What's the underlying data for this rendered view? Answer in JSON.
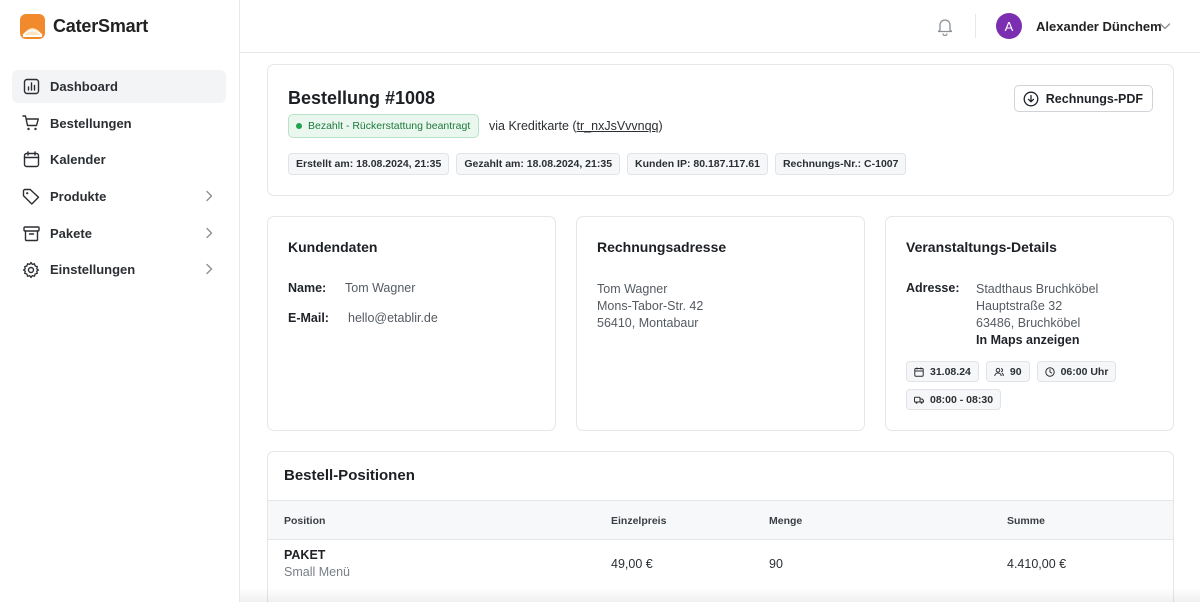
{
  "app": {
    "name": "CaterSmart"
  },
  "sidebar": {
    "items": [
      {
        "label": "Dashboard",
        "icon": "chart-icon",
        "active": true
      },
      {
        "label": "Bestellungen",
        "icon": "cart-icon"
      },
      {
        "label": "Kalender",
        "icon": "calendar-icon"
      },
      {
        "label": "Produkte",
        "icon": "tag-icon",
        "expandable": true
      },
      {
        "label": "Pakete",
        "icon": "box-icon",
        "expandable": true
      },
      {
        "label": "Einstellungen",
        "icon": "gear-icon",
        "expandable": true
      }
    ]
  },
  "topbar": {
    "user_initial": "A",
    "user_name": "Alexander Dünchem",
    "avatar_color": "#7b2fb0"
  },
  "order": {
    "title": "Bestellung #1008",
    "status": "Bezahlt - Rückerstattung beantragt",
    "payment_prefix": "via Kreditkarte (",
    "transaction_id": "tr_nxJsVvvnqq",
    "payment_suffix": ")",
    "pdf_button": "Rechnungs-PDF",
    "meta": [
      "Erstellt am: 18.08.2024, 21:35",
      "Gezahlt am: 18.08.2024, 21:35",
      "Kunden IP: 80.187.117.61",
      "Rechnungs-Nr.: C-1007"
    ]
  },
  "customer": {
    "title": "Kundendaten",
    "name_label": "Name:",
    "name_value": "Tom Wagner",
    "email_label": "E-Mail:",
    "email_value": "hello@etablir.de"
  },
  "billing": {
    "title": "Rechnungsadresse",
    "lines": [
      "Tom Wagner",
      "Mons-Tabor-Str. 42",
      "56410, Montabaur"
    ]
  },
  "event": {
    "title": "Veranstaltungs-Details",
    "address_label": "Adresse:",
    "address_lines": [
      "Stadthaus Bruchköbel",
      "Hauptstraße 32",
      "63486, Bruchköbel"
    ],
    "maps_link": "In Maps anzeigen",
    "date": "31.08.24",
    "guests": "90",
    "time": "06:00 Uhr",
    "delivery": "08:00 - 08:30"
  },
  "items": {
    "title": "Bestell-Positionen",
    "columns": [
      "Position",
      "Einzelpreis",
      "Menge",
      "Summe"
    ],
    "rows": [
      {
        "name": "PAKET",
        "sub": "Small Menü",
        "price": "49,00 €",
        "qty": "90",
        "sum": "4.410,00 €"
      }
    ]
  },
  "colors": {
    "accent": "#7b2fb0",
    "status_green": "#22a351",
    "brand_orange": "#f08a2c"
  }
}
